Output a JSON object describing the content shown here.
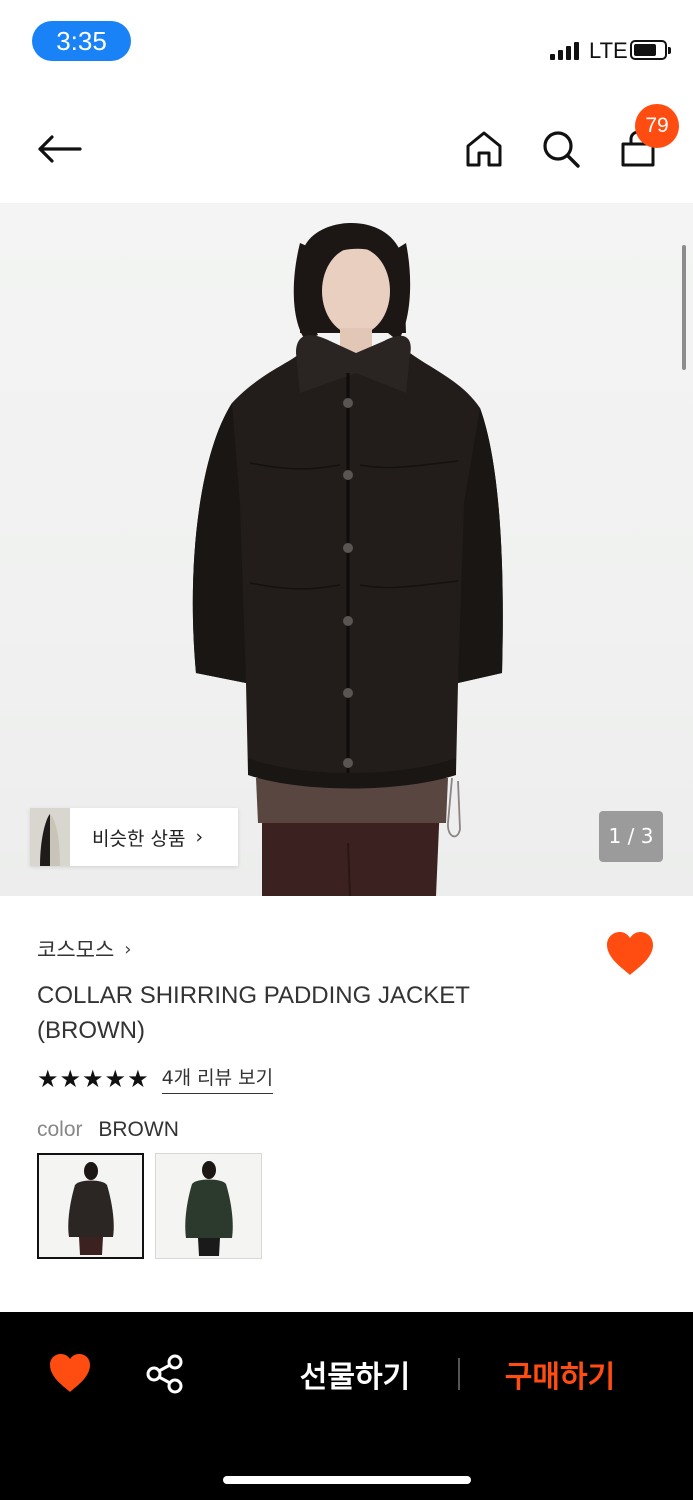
{
  "status_bar": {
    "time": "3:35",
    "network": "LTE"
  },
  "nav": {
    "back_icon": "arrow-left-icon",
    "home_icon": "home-icon",
    "search_icon": "search-icon",
    "cart_icon": "shopping-bag-icon",
    "cart_count": "79"
  },
  "gallery": {
    "similar_label": "비슷한 상품",
    "similar_chevron": "›",
    "page_counter": "1 / 3"
  },
  "product": {
    "brand": "코스모스",
    "brand_chevron": "›",
    "title": "COLLAR SHIRRING PADDING JACKET (BROWN)",
    "rating_stars": "★★★★★",
    "rating": 5,
    "review_link": "4개 리뷰 보기",
    "color_label": "color",
    "color_value": "BROWN",
    "swatches": [
      {
        "color": "#2b2624",
        "selected": true
      },
      {
        "color": "#2c3a2e",
        "selected": false
      }
    ]
  },
  "bottom_bar": {
    "gift_label": "선물하기",
    "buy_label": "구매하기",
    "wish_icon": "heart-icon",
    "share_icon": "share-icon"
  },
  "colors": {
    "accent": "#ff4d12",
    "status_pill": "#1a82f7",
    "bottom_bar": "#000000"
  }
}
